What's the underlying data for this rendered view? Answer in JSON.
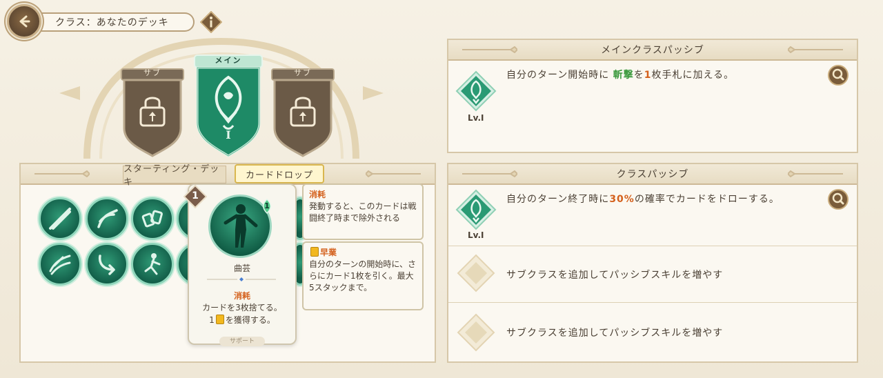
{
  "header": {
    "title": "クラス：あなたのデッキ"
  },
  "classes": {
    "sub_left_label": "サブ",
    "main_label": "メイン",
    "main_rank": "I",
    "sub_right_label": "サブ"
  },
  "main_passive": {
    "header": "メインクラスパッシブ",
    "level": "Lv.I",
    "text_pre": "自分のターン開始時に",
    "text_kw": "斬撃",
    "text_mid": "を",
    "text_num": "1",
    "text_post": "枚手札に加える。"
  },
  "class_passive": {
    "header": "クラスパッシブ",
    "level": "Lv.I",
    "text_pre": "自分のターン終了時に",
    "text_pct": "30%",
    "text_post": "の確率でカードをドローする。",
    "empty_slot_1": "サブクラスを追加してパッシブスキルを増やす",
    "empty_slot_2": "サブクラスを追加してパッシブスキルを増やす"
  },
  "deck": {
    "tab_starting": "スターティング・デッキ",
    "tab_drop": "カードドロップ"
  },
  "card": {
    "cost": "1",
    "gem": "1",
    "name": "曲芸",
    "keyword": "消耗",
    "desc_line1": "カードを3枚捨てる。",
    "desc_line2_pre": "1",
    "desc_line2_post": "を獲得する。",
    "type": "サポート"
  },
  "tooltips": {
    "exhaust_title": "消耗",
    "exhaust_text": "発動すると、このカードは戦闘終了時まで除外される",
    "early_title": "早業",
    "early_text": "自分のターンの開始時に、さらにカード1枚を引く。最大5スタックまで。"
  },
  "colors": {
    "accent_green": "#3c9a3e",
    "accent_orange": "#d4601c",
    "emblem_teal": "#1e8a66"
  }
}
